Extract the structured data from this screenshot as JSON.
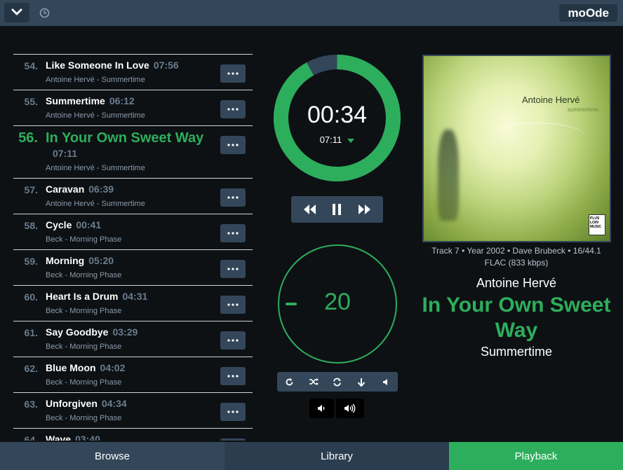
{
  "brand": "moOde",
  "playlist": [
    {
      "num": "54.",
      "title": "Like Someone In Love",
      "time": "07:56",
      "sub": "Antoine Hervé - Summertime"
    },
    {
      "num": "55.",
      "title": "Summertime",
      "time": "06:12",
      "sub": "Antoine Hervé - Summertime"
    },
    {
      "num": "56.",
      "title": "In Your Own Sweet Way",
      "time": "07:11",
      "sub": "Antoine Hervé - Summertime"
    },
    {
      "num": "57.",
      "title": "Caravan",
      "time": "06:39",
      "sub": "Antoine Hervé - Summertime"
    },
    {
      "num": "58.",
      "title": "Cycle",
      "time": "00:41",
      "sub": "Beck - Morning Phase"
    },
    {
      "num": "59.",
      "title": "Morning",
      "time": "05:20",
      "sub": "Beck - Morning Phase"
    },
    {
      "num": "60.",
      "title": "Heart Is a Drum",
      "time": "04:31",
      "sub": "Beck - Morning Phase"
    },
    {
      "num": "61.",
      "title": "Say Goodbye",
      "time": "03:29",
      "sub": "Beck - Morning Phase"
    },
    {
      "num": "62.",
      "title": "Blue Moon",
      "time": "04:02",
      "sub": "Beck - Morning Phase"
    },
    {
      "num": "63.",
      "title": "Unforgiven",
      "time": "04:34",
      "sub": "Beck - Morning Phase"
    },
    {
      "num": "64.",
      "title": "Wave",
      "time": "03:40",
      "sub": ""
    }
  ],
  "playback": {
    "elapsed": "00:34",
    "total": "07:11",
    "progress_fraction": 0.92,
    "volume": "20",
    "volume_fraction": 0.2
  },
  "cover": {
    "artist_text": "Antoine Hervé",
    "album_text": "summertime",
    "logo_text": "PLUS LOIN MUSIC"
  },
  "now_playing": {
    "meta_line1": "Track 7 • Year 2002 • Dave Brubeck • 16/44.1",
    "meta_line2": "FLAC (833 kbps)",
    "artist": "Antoine Hervé",
    "title": "In Your Own Sweet Way",
    "album": "Summertime"
  },
  "nav": {
    "browse": "Browse",
    "library": "Library",
    "playback": "Playback"
  },
  "colors": {
    "accent": "#2dae5c",
    "panel": "#34475a",
    "background": "#0d1114"
  },
  "icons": {
    "menu": "chevron-down-icon",
    "clock": "clock-icon",
    "more": "ellipsis-icon",
    "prev": "rewind-icon",
    "pause": "pause-icon",
    "next": "fast-forward-icon",
    "repeat": "repeat-icon",
    "shuffle": "shuffle-icon",
    "consume": "sync-icon",
    "single": "arrow-down-icon",
    "mute": "speaker-icon"
  }
}
